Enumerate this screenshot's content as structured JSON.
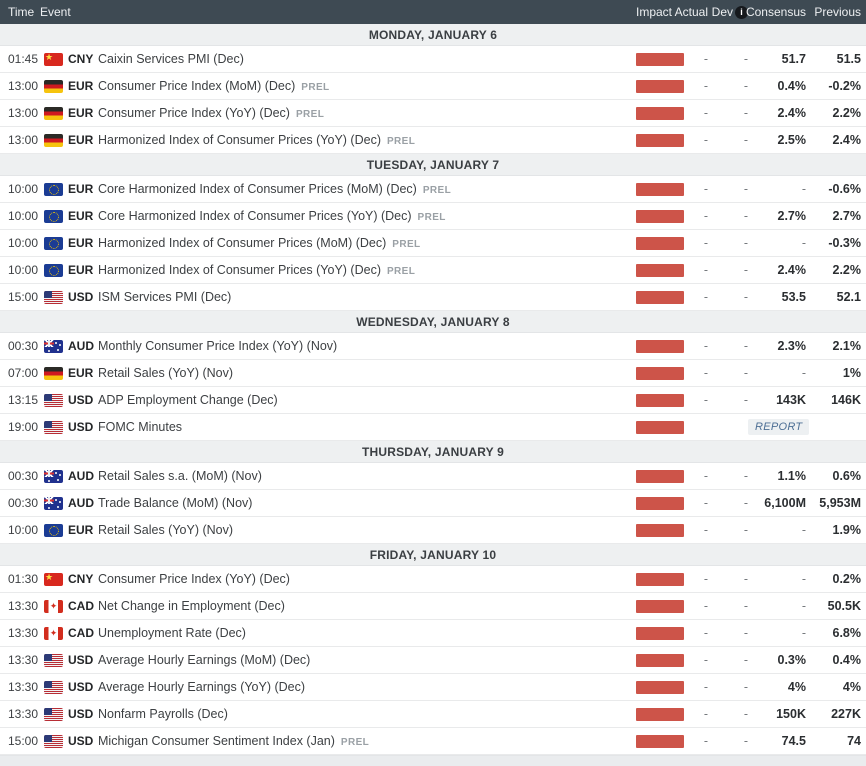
{
  "columns": {
    "time": "Time",
    "event": "Event",
    "impact": "Impact",
    "actual": "Actual",
    "dev": "Dev",
    "consensus": "Consensus",
    "previous": "Previous"
  },
  "labels": {
    "prel": "PREL",
    "report": "REPORT",
    "info_icon": "i"
  },
  "colors": {
    "header_bg": "#3e4a53",
    "day_header_bg": "#eef0f1",
    "impact_high": "#cd5449",
    "report_link": "#4c6e94",
    "row_border": "#e9eaeb"
  },
  "days": [
    {
      "label": "MONDAY, JANUARY 6",
      "events": [
        {
          "time": "01:45",
          "flag": "cn",
          "currency": "CNY",
          "name": "Caixin Services PMI (Dec)",
          "prel": false,
          "impact": "high",
          "actual": "-",
          "dev": "-",
          "consensus": "51.7",
          "previous": "51.5"
        },
        {
          "time": "13:00",
          "flag": "de",
          "currency": "EUR",
          "name": "Consumer Price Index (MoM) (Dec)",
          "prel": true,
          "impact": "high",
          "actual": "-",
          "dev": "-",
          "consensus": "0.4%",
          "previous": "-0.2%"
        },
        {
          "time": "13:00",
          "flag": "de",
          "currency": "EUR",
          "name": "Consumer Price Index (YoY) (Dec)",
          "prel": true,
          "impact": "high",
          "actual": "-",
          "dev": "-",
          "consensus": "2.4%",
          "previous": "2.2%"
        },
        {
          "time": "13:00",
          "flag": "de",
          "currency": "EUR",
          "name": "Harmonized Index of Consumer Prices (YoY) (Dec)",
          "prel": true,
          "impact": "high",
          "actual": "-",
          "dev": "-",
          "consensus": "2.5%",
          "previous": "2.4%"
        }
      ]
    },
    {
      "label": "TUESDAY, JANUARY 7",
      "events": [
        {
          "time": "10:00",
          "flag": "eu",
          "currency": "EUR",
          "name": "Core Harmonized Index of Consumer Prices (MoM) (Dec)",
          "prel": true,
          "impact": "high",
          "actual": "-",
          "dev": "-",
          "consensus": "-",
          "previous": "-0.6%"
        },
        {
          "time": "10:00",
          "flag": "eu",
          "currency": "EUR",
          "name": "Core Harmonized Index of Consumer Prices (YoY) (Dec)",
          "prel": true,
          "impact": "high",
          "actual": "-",
          "dev": "-",
          "consensus": "2.7%",
          "previous": "2.7%"
        },
        {
          "time": "10:00",
          "flag": "eu",
          "currency": "EUR",
          "name": "Harmonized Index of Consumer Prices (MoM) (Dec)",
          "prel": true,
          "impact": "high",
          "actual": "-",
          "dev": "-",
          "consensus": "-",
          "previous": "-0.3%"
        },
        {
          "time": "10:00",
          "flag": "eu",
          "currency": "EUR",
          "name": "Harmonized Index of Consumer Prices (YoY) (Dec)",
          "prel": true,
          "impact": "high",
          "actual": "-",
          "dev": "-",
          "consensus": "2.4%",
          "previous": "2.2%"
        },
        {
          "time": "15:00",
          "flag": "us",
          "currency": "USD",
          "name": "ISM Services PMI (Dec)",
          "prel": false,
          "impact": "high",
          "actual": "-",
          "dev": "-",
          "consensus": "53.5",
          "previous": "52.1"
        }
      ]
    },
    {
      "label": "WEDNESDAY, JANUARY 8",
      "events": [
        {
          "time": "00:30",
          "flag": "au",
          "currency": "AUD",
          "name": "Monthly Consumer Price Index (YoY) (Nov)",
          "prel": false,
          "impact": "high",
          "actual": "-",
          "dev": "-",
          "consensus": "2.3%",
          "previous": "2.1%"
        },
        {
          "time": "07:00",
          "flag": "de",
          "currency": "EUR",
          "name": "Retail Sales (YoY) (Nov)",
          "prel": false,
          "impact": "high",
          "actual": "-",
          "dev": "-",
          "consensus": "-",
          "previous": "1%"
        },
        {
          "time": "13:15",
          "flag": "us",
          "currency": "USD",
          "name": "ADP Employment Change (Dec)",
          "prel": false,
          "impact": "high",
          "actual": "-",
          "dev": "-",
          "consensus": "143K",
          "previous": "146K"
        },
        {
          "time": "19:00",
          "flag": "us",
          "currency": "USD",
          "name": "FOMC Minutes",
          "prel": false,
          "impact": "high",
          "report": true,
          "actual": "",
          "dev": "",
          "consensus": "",
          "previous": ""
        }
      ]
    },
    {
      "label": "THURSDAY, JANUARY 9",
      "events": [
        {
          "time": "00:30",
          "flag": "au",
          "currency": "AUD",
          "name": "Retail Sales s.a. (MoM) (Nov)",
          "prel": false,
          "impact": "high",
          "actual": "-",
          "dev": "-",
          "consensus": "1.1%",
          "previous": "0.6%"
        },
        {
          "time": "00:30",
          "flag": "au",
          "currency": "AUD",
          "name": "Trade Balance (MoM) (Nov)",
          "prel": false,
          "impact": "high",
          "actual": "-",
          "dev": "-",
          "consensus": "6,100M",
          "previous": "5,953M"
        },
        {
          "time": "10:00",
          "flag": "eu",
          "currency": "EUR",
          "name": "Retail Sales (YoY) (Nov)",
          "prel": false,
          "impact": "high",
          "actual": "-",
          "dev": "-",
          "consensus": "-",
          "previous": "1.9%"
        }
      ]
    },
    {
      "label": "FRIDAY, JANUARY 10",
      "events": [
        {
          "time": "01:30",
          "flag": "cn",
          "currency": "CNY",
          "name": "Consumer Price Index (YoY) (Dec)",
          "prel": false,
          "impact": "high",
          "actual": "-",
          "dev": "-",
          "consensus": "-",
          "previous": "0.2%"
        },
        {
          "time": "13:30",
          "flag": "ca",
          "currency": "CAD",
          "name": "Net Change in Employment (Dec)",
          "prel": false,
          "impact": "high",
          "actual": "-",
          "dev": "-",
          "consensus": "-",
          "previous": "50.5K"
        },
        {
          "time": "13:30",
          "flag": "ca",
          "currency": "CAD",
          "name": "Unemployment Rate (Dec)",
          "prel": false,
          "impact": "high",
          "actual": "-",
          "dev": "-",
          "consensus": "-",
          "previous": "6.8%"
        },
        {
          "time": "13:30",
          "flag": "us",
          "currency": "USD",
          "name": "Average Hourly Earnings (MoM) (Dec)",
          "prel": false,
          "impact": "high",
          "actual": "-",
          "dev": "-",
          "consensus": "0.3%",
          "previous": "0.4%"
        },
        {
          "time": "13:30",
          "flag": "us",
          "currency": "USD",
          "name": "Average Hourly Earnings (YoY) (Dec)",
          "prel": false,
          "impact": "high",
          "actual": "-",
          "dev": "-",
          "consensus": "4%",
          "previous": "4%"
        },
        {
          "time": "13:30",
          "flag": "us",
          "currency": "USD",
          "name": "Nonfarm Payrolls (Dec)",
          "prel": false,
          "impact": "high",
          "actual": "-",
          "dev": "-",
          "consensus": "150K",
          "previous": "227K"
        },
        {
          "time": "15:00",
          "flag": "us",
          "currency": "USD",
          "name": "Michigan Consumer Sentiment Index (Jan)",
          "prel": true,
          "impact": "high",
          "actual": "-",
          "dev": "-",
          "consensus": "74.5",
          "previous": "74"
        }
      ]
    }
  ]
}
